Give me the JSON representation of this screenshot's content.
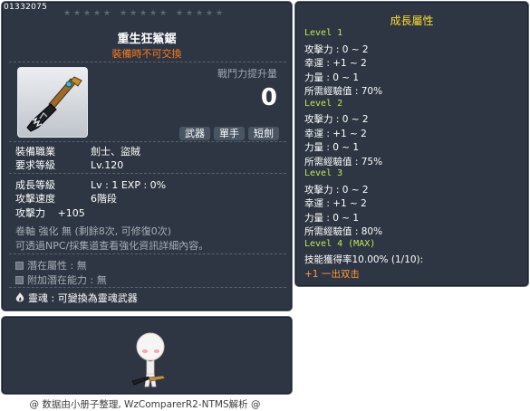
{
  "item": {
    "id": "01332075",
    "name": "重生狂鯊鋸",
    "trade_note": "裝備時不可交換",
    "power_label": "戰鬥力提升量",
    "power_value": "0",
    "tags": [
      "武器",
      "單手",
      "短劍"
    ],
    "job_label": "裝備職業",
    "job_value": "劍士、盜賊",
    "req_level_label": "要求等級",
    "req_level_value": "Lv.120",
    "growth_level_label": "成長等級",
    "growth_level_value": "Lv : 1   EXP : 0%",
    "attack_speed_label": "攻擊速度",
    "attack_speed_value": "6階段",
    "attack_label": "攻擊力",
    "attack_value": "+105",
    "scroll_text": "卷軸 強化 無 (剩餘8次, 可修復0次)",
    "npc_text": "可透過NPC/採集道查看強化資訊詳細內容。",
    "potential_text": "潛在屬性   : 無",
    "bonus_potential_text": "附加潛在能力  : 無",
    "soul_text": "靈魂  : 可變換為靈魂武器"
  },
  "growth": {
    "title": "成長屬性",
    "lines": [
      {
        "text": "Level 1",
        "kind": "level"
      },
      {
        "text": "攻擊力 : 0 ~ 2",
        "kind": "stat"
      },
      {
        "text": "幸運 : +1 ~ 2",
        "kind": "stat"
      },
      {
        "text": "力量 : 0 ~ 1",
        "kind": "stat"
      },
      {
        "text": "所需經驗值 : 70%",
        "kind": "stat"
      },
      {
        "text": "Level 2",
        "kind": "level"
      },
      {
        "text": "攻擊力 : 0 ~ 2",
        "kind": "stat"
      },
      {
        "text": "幸運 : +1 ~ 2",
        "kind": "stat"
      },
      {
        "text": "力量 : 0 ~ 1",
        "kind": "stat"
      },
      {
        "text": "所需經驗值 : 75%",
        "kind": "stat"
      },
      {
        "text": "Level 3",
        "kind": "level"
      },
      {
        "text": "攻擊力 : 0 ~ 2",
        "kind": "stat"
      },
      {
        "text": "幸運 : +1 ~ 2",
        "kind": "stat"
      },
      {
        "text": "力量 : 0 ~ 1",
        "kind": "stat"
      },
      {
        "text": "所需經驗值 : 80%",
        "kind": "stat"
      },
      {
        "text": "Level 4 (MAX)",
        "kind": "level"
      },
      {
        "text": "技能獲得率10.00% (1/10):",
        "kind": "stat"
      },
      {
        "text": "+1 一出双击",
        "kind": "skill"
      }
    ]
  },
  "footer": "@ 数据由小册子整理, WzComparerR2-NTMS解析 @",
  "colors": {
    "panel_bg": "#2d3642",
    "trade_note": "#ff7a1a",
    "growth_title": "#ffdd33",
    "level_heading": "#c3e65a",
    "skill_line": "#ff9a3c"
  },
  "icons": {
    "item_icon": "shark-saw-dagger-icon",
    "potential": "gray-square-bullet-icon",
    "soul": "soul-flame-icon"
  }
}
